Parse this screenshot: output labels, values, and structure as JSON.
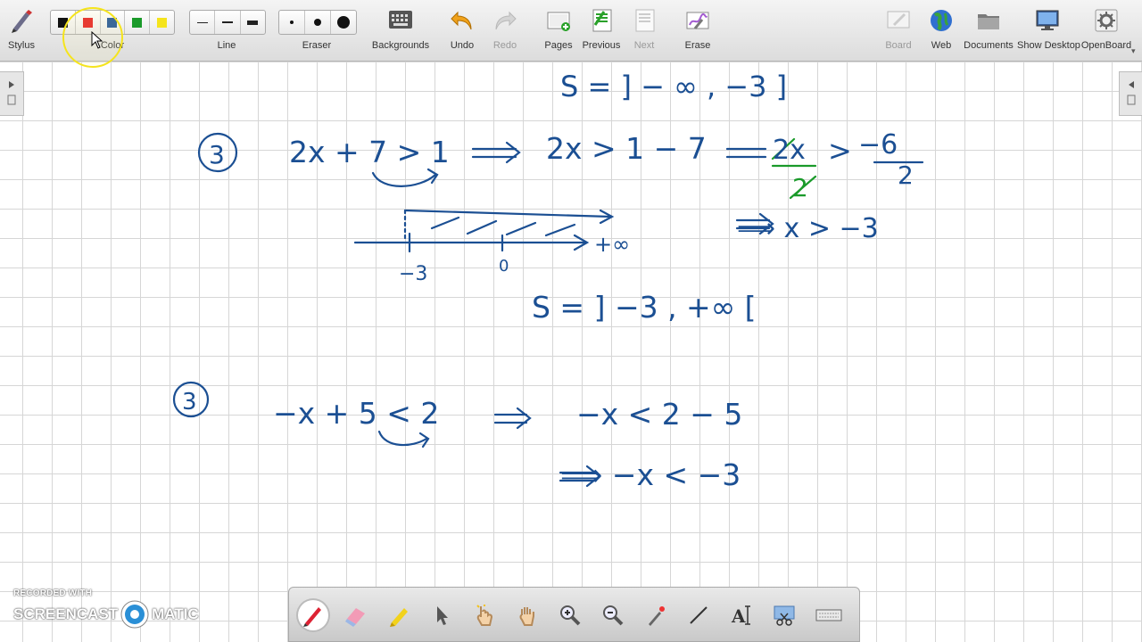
{
  "toolbar": {
    "stylus": {
      "label": "Stylus",
      "icon": "stylus-icon"
    },
    "color": {
      "label": "Color",
      "swatches": [
        "#111111",
        "#e31b1b",
        "#1b4f93",
        "#1a9a2a",
        "#f5e41c"
      ]
    },
    "line": {
      "label": "Line",
      "widths": [
        "thin",
        "medium",
        "thick"
      ]
    },
    "eraser": {
      "label": "Eraser",
      "sizes": [
        "small",
        "medium",
        "large"
      ]
    },
    "backgrounds": {
      "label": "Backgrounds",
      "icon": "keyboard-icon"
    },
    "undo": {
      "label": "Undo",
      "icon": "undo-icon"
    },
    "redo": {
      "label": "Redo",
      "icon": "redo-icon"
    },
    "pages": {
      "label": "Pages",
      "icon": "pages-icon"
    },
    "previous": {
      "label": "Previous",
      "icon": "previous-icon"
    },
    "next": {
      "label": "Next",
      "icon": "next-icon"
    },
    "erase": {
      "label": "Erase",
      "icon": "erase-icon"
    },
    "board": {
      "label": "Board",
      "icon": "board-icon"
    },
    "web": {
      "label": "Web",
      "icon": "globe-icon"
    },
    "documents": {
      "label": "Documents",
      "icon": "folder-icon"
    },
    "show_desktop": {
      "label": "Show Desktop",
      "icon": "monitor-icon"
    },
    "openboard": {
      "label": "OpenBoard",
      "icon": "gear-icon"
    }
  },
  "board": {
    "ink_color": "#1b4f93",
    "green_ink": "#1a9a2a",
    "lines": {
      "top_solution": "S = ] − ∞ , −3 ]",
      "item1_label": "3",
      "item1_eq": "2x + 7 > 1",
      "item1_step1": "2x > 1 − 7",
      "item1_step2_num": "−6",
      "item1_step2_den": "2",
      "item1_step2_lhs_num": "2x",
      "item1_step2_lhs_den": "2",
      "item1_step3": "⟹ x > −3",
      "axis_left": "−3",
      "axis_zero": "0",
      "axis_right": "+∞",
      "item1_solution": "S = ] −3 , +∞ [",
      "item2_label": "3",
      "item2_eq": "−x + 5 < 2",
      "item2_step1": "−x < 2 − 5",
      "item2_step2": "⟹ −x < −3"
    }
  },
  "watermark": {
    "line1": "RECORDED WITH",
    "line2a": "SCREENCAST",
    "line2b": "MATIC"
  }
}
